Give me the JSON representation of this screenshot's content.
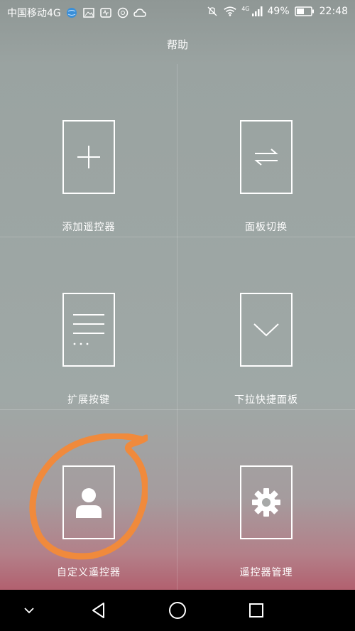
{
  "status_bar": {
    "carrier": "中国移动4G",
    "network_badge": "4G",
    "battery": "49%",
    "time": "22:48",
    "icons": [
      "globe-icon",
      "gallery-icon",
      "heart-icon",
      "chat-icon",
      "weather-icon",
      "mute-icon",
      "wifi-icon",
      "signal-icon",
      "battery-icon"
    ]
  },
  "header": {
    "title": "帮助"
  },
  "tiles": [
    {
      "label": "添加遥控器",
      "icon": "plus-icon"
    },
    {
      "label": "面板切换",
      "icon": "swap-icon"
    },
    {
      "label": "扩展按键",
      "icon": "lines-icon"
    },
    {
      "label": "下拉快捷面板",
      "icon": "chevron-down-icon"
    },
    {
      "label": "自定义遥控器",
      "icon": "person-icon"
    },
    {
      "label": "遥控器管理",
      "icon": "gear-icon"
    }
  ],
  "annotation": {
    "color": "#f08a3c"
  },
  "nav_bar": {
    "buttons": [
      "collapse-icon",
      "back-icon",
      "home-icon",
      "recents-icon"
    ]
  }
}
